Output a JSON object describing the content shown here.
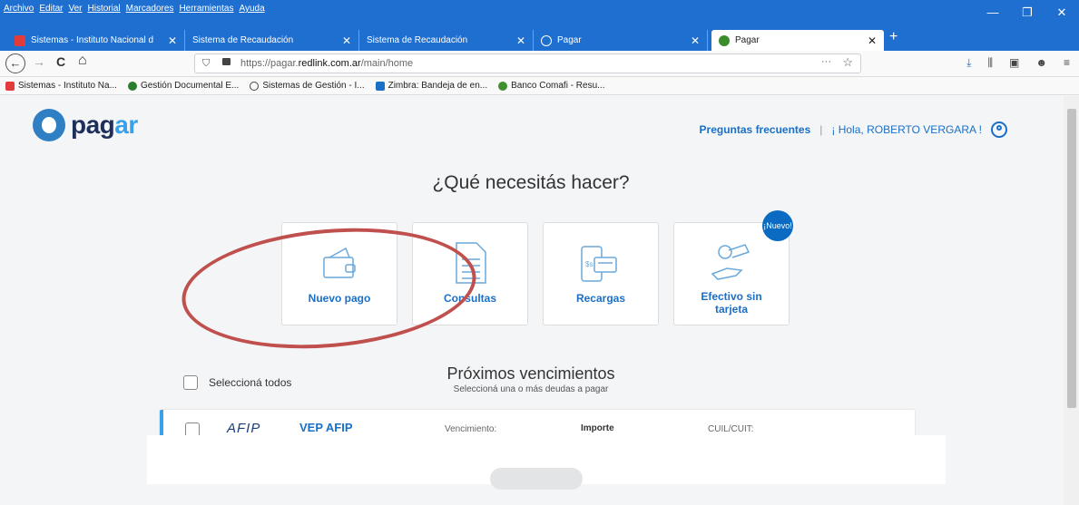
{
  "menu": [
    "Archivo",
    "Editar",
    "Ver",
    "Historial",
    "Marcadores",
    "Herramientas",
    "Ayuda"
  ],
  "window_controls": [
    "—",
    "❐",
    "✕"
  ],
  "tabs": [
    {
      "title": "Sistemas - Instituto Nacional d",
      "close": "✕",
      "favicon": "#e23b3b"
    },
    {
      "title": "Sistema de Recaudación",
      "close": "✕"
    },
    {
      "title": "Sistema de Recaudación",
      "close": "✕"
    },
    {
      "title": "Pagar",
      "close": "✕"
    },
    {
      "title": "Pagar",
      "close": "✕",
      "active": true
    }
  ],
  "new_tab": "+",
  "nav": {
    "back": "←",
    "forward": "→",
    "reload": "C",
    "home": "⌂",
    "url_prefix": "https://pagar.",
    "url_domain": "redlink.com.ar",
    "url_path": "/main/home",
    "more": "···",
    "bookmark_star": "☆",
    "tools": [
      "⤓",
      "⫼",
      "▣",
      "☻",
      "≡"
    ]
  },
  "bookmarks": [
    {
      "label": "Sistemas - Instituto Na...",
      "color": "#e23b3b"
    },
    {
      "label": "Gestión Documental E...",
      "color": "#2a7d2a"
    },
    {
      "label": "Sistemas de Gestión - I...",
      "color": "#444444"
    },
    {
      "label": "Zimbra: Bandeja de en...",
      "color": "#1a6fc7"
    },
    {
      "label": "Banco Comafi - Resu...",
      "color": "#3f8f2f"
    }
  ],
  "header": {
    "logo_main": "pag",
    "logo_accent": "ar",
    "faq": "Preguntas frecuentes",
    "separator": "|",
    "greeting": "¡ Hola, ROBERTO VERGARA !"
  },
  "question": "¿Qué necesitás hacer?",
  "cards": [
    {
      "label": "Nuevo pago"
    },
    {
      "label": "Consultas"
    },
    {
      "label": "Recargas"
    },
    {
      "label": "Efectivo sin tarjeta",
      "badge": "¡Nuevo!"
    }
  ],
  "select_all": "Seleccioná todos",
  "upcoming": {
    "title": "Próximos vencimientos",
    "subtitle": "Seleccioná una o más deudas a pagar"
  },
  "row": {
    "logo": "AFIP",
    "name": "VEP AFIP",
    "due_label": "Vencimiento:",
    "amount_label": "Importe",
    "cuil_label": "CUIL/CUIT:"
  },
  "colors": {
    "browser_blue": "#1f6fd0",
    "link_blue": "#1a6fc7",
    "annotation_red": "#c0504d"
  }
}
